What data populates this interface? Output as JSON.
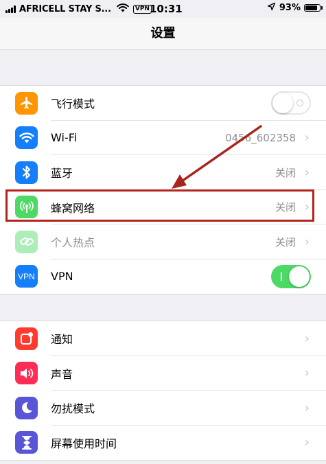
{
  "status_bar": {
    "carrier": "AFRICELL STAY S...",
    "vpn": "VPN",
    "time": "10:31",
    "battery": "93%",
    "battery_level": 0.93
  },
  "nav": {
    "title": "设置"
  },
  "group1": [
    {
      "label": "飞行模式",
      "icon": "airplane-icon",
      "icon_color": "#ff9500",
      "control": "toggle",
      "toggle_on": false
    },
    {
      "label": "Wi-Fi",
      "icon": "wifi-icon",
      "icon_color": "#157efb",
      "value": "0456_602358"
    },
    {
      "label": "蓝牙",
      "icon": "bluetooth-icon",
      "icon_color": "#157efb",
      "value": "关闭"
    },
    {
      "label": "蜂窝网络",
      "icon": "cellular-icon",
      "icon_color": "#4cd964",
      "value": "关闭"
    },
    {
      "label": "个人热点",
      "icon": "hotspot-icon",
      "icon_color": "#4cd964",
      "value": "关闭",
      "disabled": true
    },
    {
      "label": "VPN",
      "icon": "vpn-icon",
      "icon_color": "#157efb",
      "icon_text": "VPN",
      "control": "toggle",
      "toggle_on": true
    }
  ],
  "group2": [
    {
      "label": "通知",
      "icon": "notifications-icon",
      "icon_color": "#ff3b30"
    },
    {
      "label": "声音",
      "icon": "sounds-icon",
      "icon_color": "#ff2d55"
    },
    {
      "label": "勿扰模式",
      "icon": "do-not-disturb-icon",
      "icon_color": "#5856d6"
    },
    {
      "label": "屏幕使用时间",
      "icon": "screen-time-icon",
      "icon_color": "#5856d6"
    }
  ],
  "colors": {
    "highlight": "#b3221b",
    "arrow": "#a8241c",
    "toggle_on": "#4cd964"
  }
}
